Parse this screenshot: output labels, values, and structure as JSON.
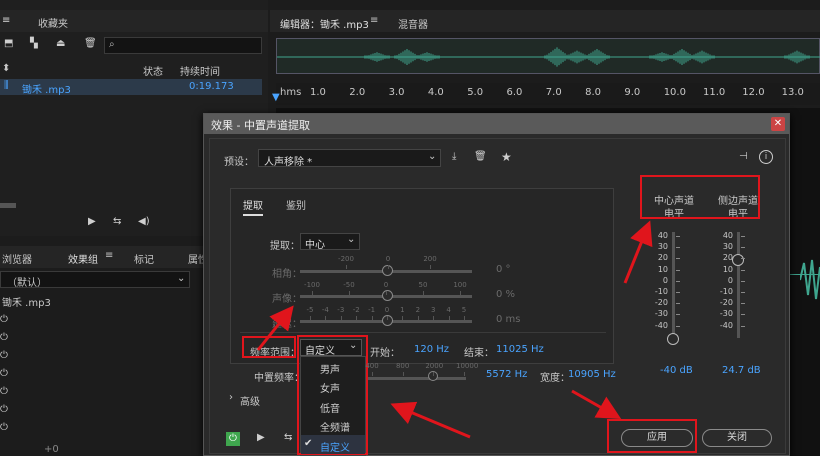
{
  "left_top": {
    "tab_folder": "",
    "tab_fav": "收藏夹",
    "col_status": "状态",
    "col_duration": "持续时间",
    "file_name": "锄禾 .mp3",
    "file_duration": "0:19.173"
  },
  "left_bottom": {
    "tab_browser": "浏览器",
    "tab_effects": "效果组",
    "tab_markers": "标记",
    "tab_props": "属性",
    "preset": "（默认）",
    "file": "锄禾 .mp3",
    "zero": "+0"
  },
  "editor": {
    "tab_editor": "编辑器：锄禾 .mp3",
    "tab_mixer": "混音器",
    "ruler_unit": "hms",
    "ruler": [
      "1.0",
      "2.0",
      "3.0",
      "4.0",
      "5.0",
      "6.0",
      "7.0",
      "8.0",
      "9.0",
      "10.0",
      "11.0",
      "12.0",
      "13.0"
    ]
  },
  "dialog": {
    "title": "效果 - 中置声道提取",
    "preset_label": "预设：",
    "preset_value": "人声移除 *",
    "tab_extract": "提取",
    "tab_identify": "鉴别",
    "extract_label": "提取：",
    "extract_value": "中心",
    "phase_label": "相角：",
    "phase_ticks": [
      "-200",
      "0",
      "200"
    ],
    "phase_value": "0 °",
    "pan_label": "声像：",
    "pan_ticks": [
      "-100",
      "-50",
      "0",
      "50",
      "100"
    ],
    "pan_value": "0 %",
    "delay_label": "延迟：",
    "delay_ticks": [
      "-5",
      "-4",
      "-3",
      "-2",
      "-1",
      "0",
      "1",
      "2",
      "3",
      "4",
      "5"
    ],
    "delay_value": "0 ms",
    "freq_label": "频率范围：",
    "freq_value": "自定义",
    "start_label": "开始：",
    "start_value": "120 Hz",
    "end_label": "结束：",
    "end_value": "11025 Hz",
    "center_freq_label": "中置频率：",
    "center_ticks": [
      "400",
      "800",
      "2000",
      "10000"
    ],
    "center_freq_value": "5572 Hz",
    "width_label": "宽度：",
    "width_value": "10905 Hz",
    "advanced": "高级",
    "meter_center": "中心声道电平",
    "meter_side": "侧边声道电平",
    "meter_ticks": [
      "40",
      "30",
      "20",
      "10",
      "0",
      "-10",
      "-20",
      "-30",
      "-40"
    ],
    "center_level": "-40 dB",
    "side_level": "24.7 dB",
    "apply": "应用",
    "close": "关闭",
    "options": [
      "男声",
      "女声",
      "低音",
      "全频谱",
      "自定义"
    ]
  },
  "colors": {
    "accent": "#4aa4ff",
    "waveform": "#3fa68f",
    "highlight": "#e0151c",
    "power": "#3fa64e"
  }
}
